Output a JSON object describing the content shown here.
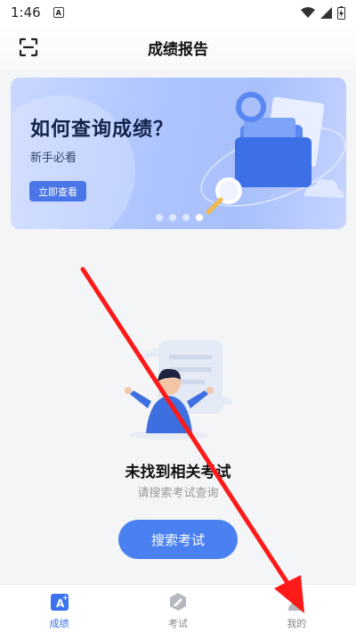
{
  "status_bar": {
    "time": "1:46"
  },
  "header": {
    "title": "成绩报告",
    "scan_icon": "scan-icon"
  },
  "banner": {
    "heading": "如何查询成绩？",
    "subtitle": "新手必看",
    "button_label": "立即查看",
    "slide_count": 4,
    "active_slide": 4
  },
  "empty_state": {
    "title": "未找到相关考试",
    "subtitle": "请搜索考试查询",
    "button_label": "搜索考试"
  },
  "tabbar": {
    "tabs": [
      {
        "label": "成绩",
        "icon": "grade-icon",
        "active": true
      },
      {
        "label": "考试",
        "icon": "exam-icon",
        "active": false
      },
      {
        "label": "我的",
        "icon": "profile-icon",
        "active": false
      }
    ]
  },
  "colors": {
    "accent": "#4a80f0",
    "annotation_arrow": "#ff1a1a"
  }
}
